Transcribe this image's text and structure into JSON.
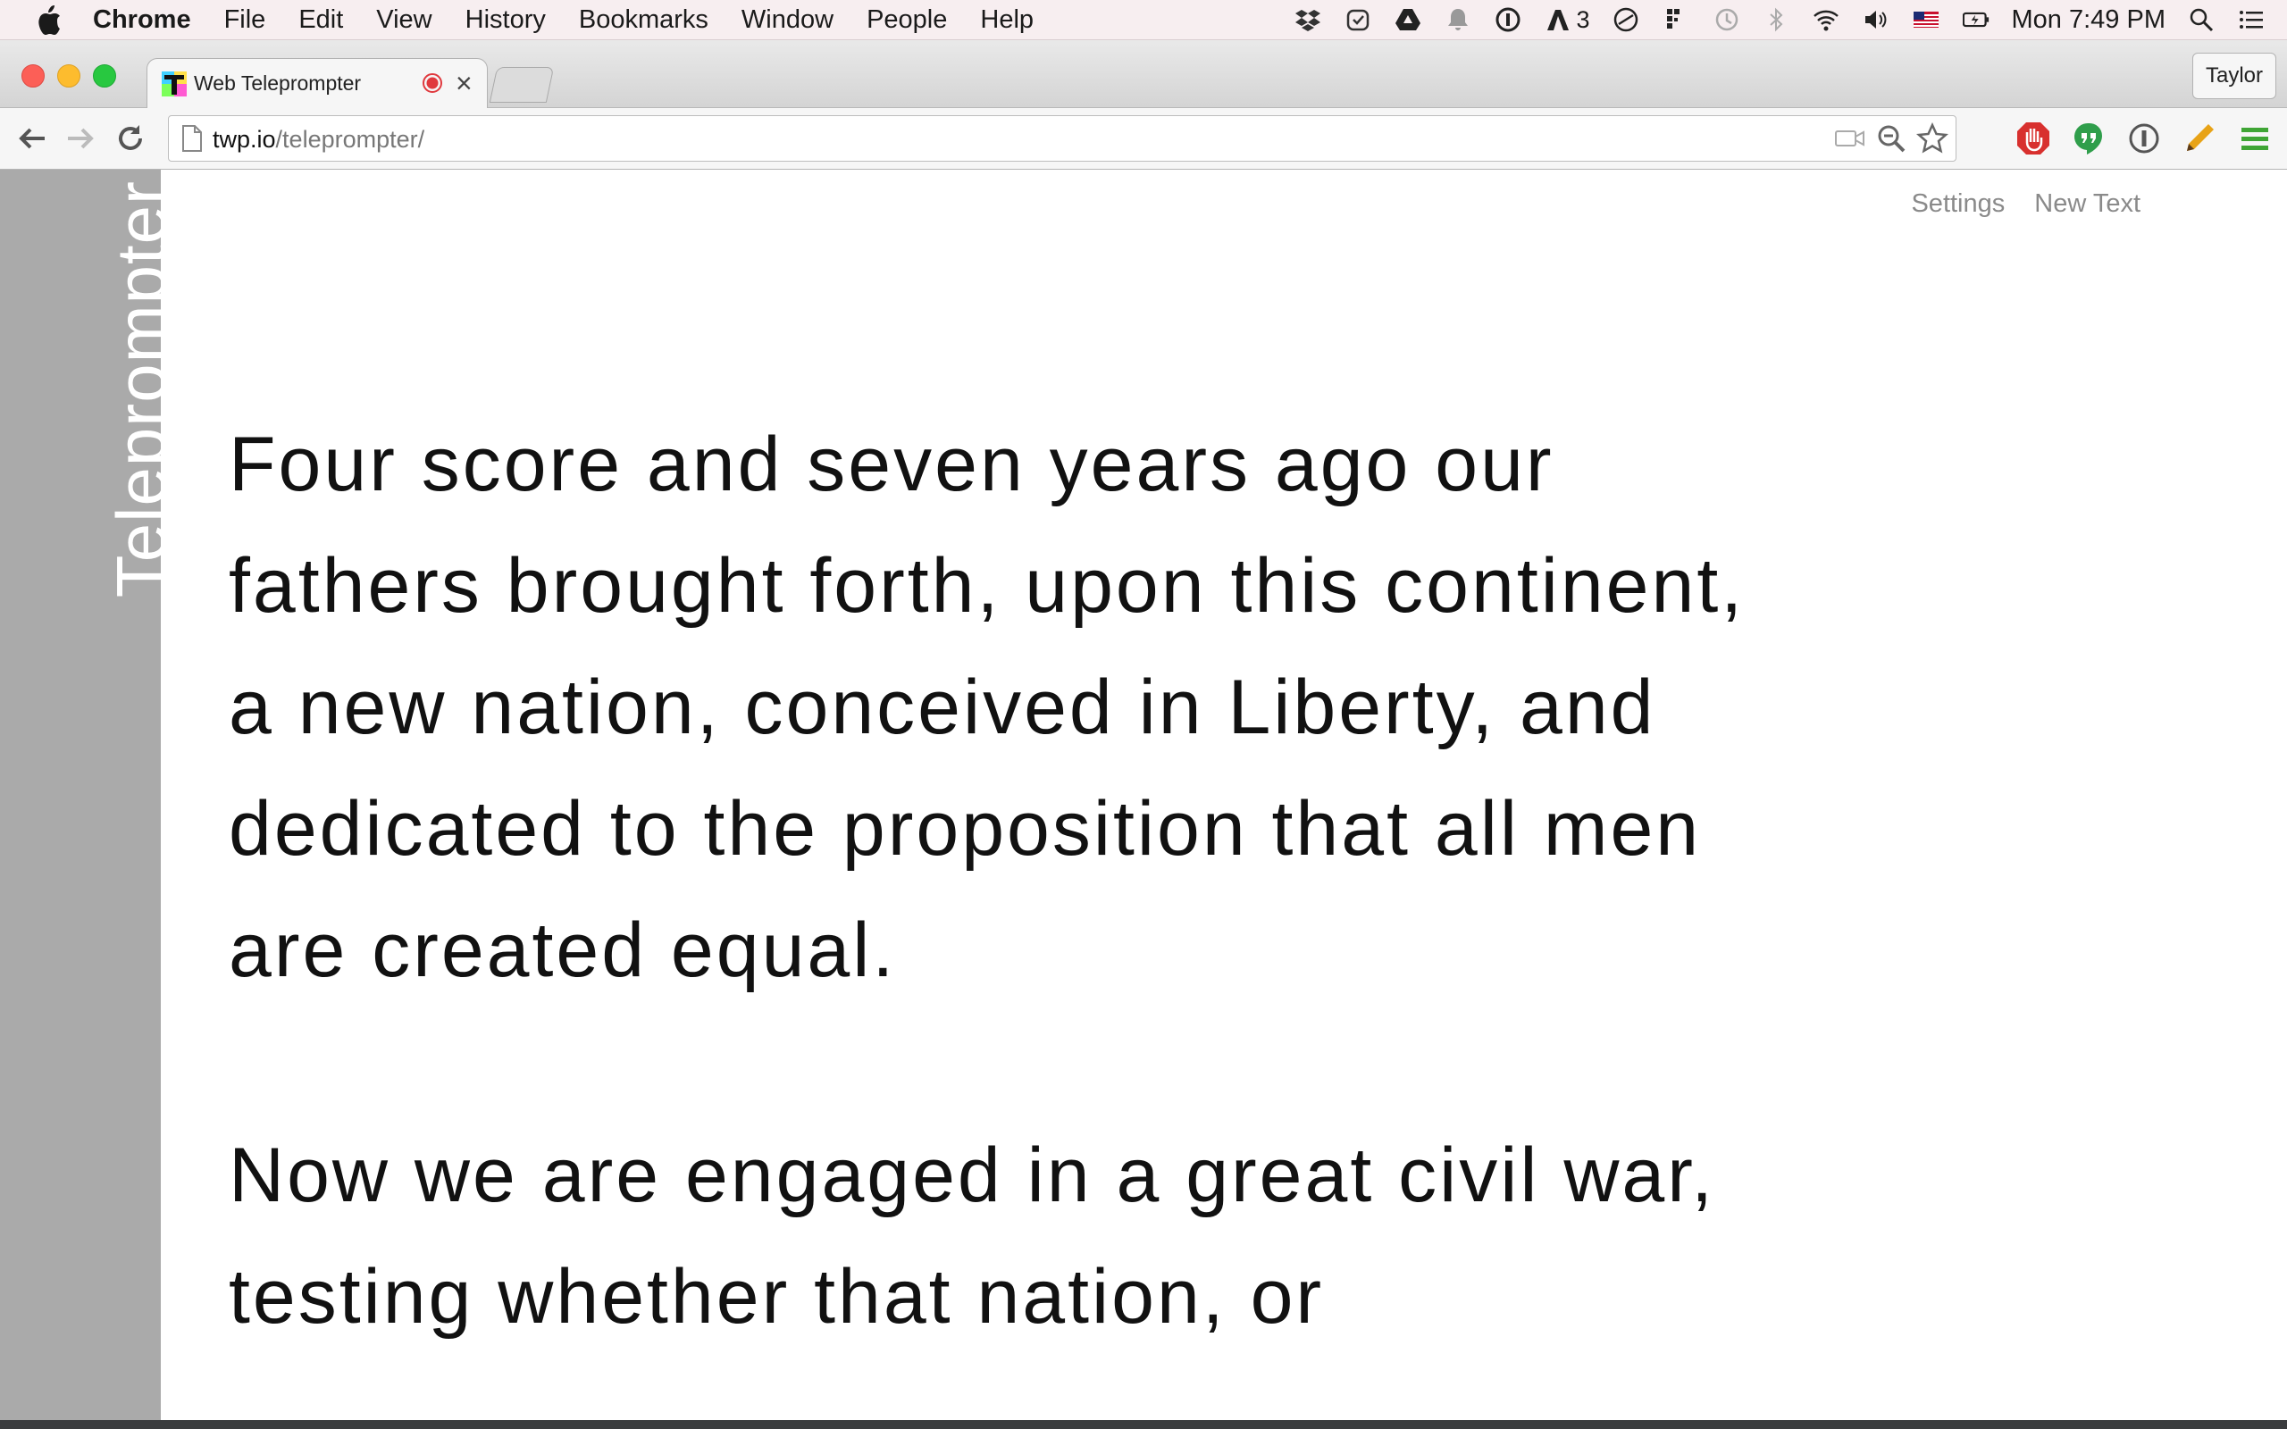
{
  "menubar": {
    "app_name": "Chrome",
    "items": [
      "File",
      "Edit",
      "View",
      "History",
      "Bookmarks",
      "Window",
      "People",
      "Help"
    ],
    "notification_count": "3",
    "clock": "Mon 7:49 PM"
  },
  "browser": {
    "tab_title": "Web Teleprompter",
    "profile_name": "Taylor",
    "url_host": "twp.io",
    "url_path": "/teleprompter/"
  },
  "page": {
    "brand": "Teleprompter",
    "nav": {
      "settings": "Settings",
      "new_text": "New Text"
    },
    "paragraphs": [
      "Four score and seven years ago our fathers brought forth, upon this continent, a new nation, conceived in Liberty, and dedicated to the proposition that all men are created equal.",
      "Now we are engaged in a great civil war, testing whether that nation, or"
    ]
  },
  "colors": {
    "sidebar": "#aaaaaa",
    "record_dot": "#e0393e",
    "menubar_bg": "#f7eef0"
  }
}
